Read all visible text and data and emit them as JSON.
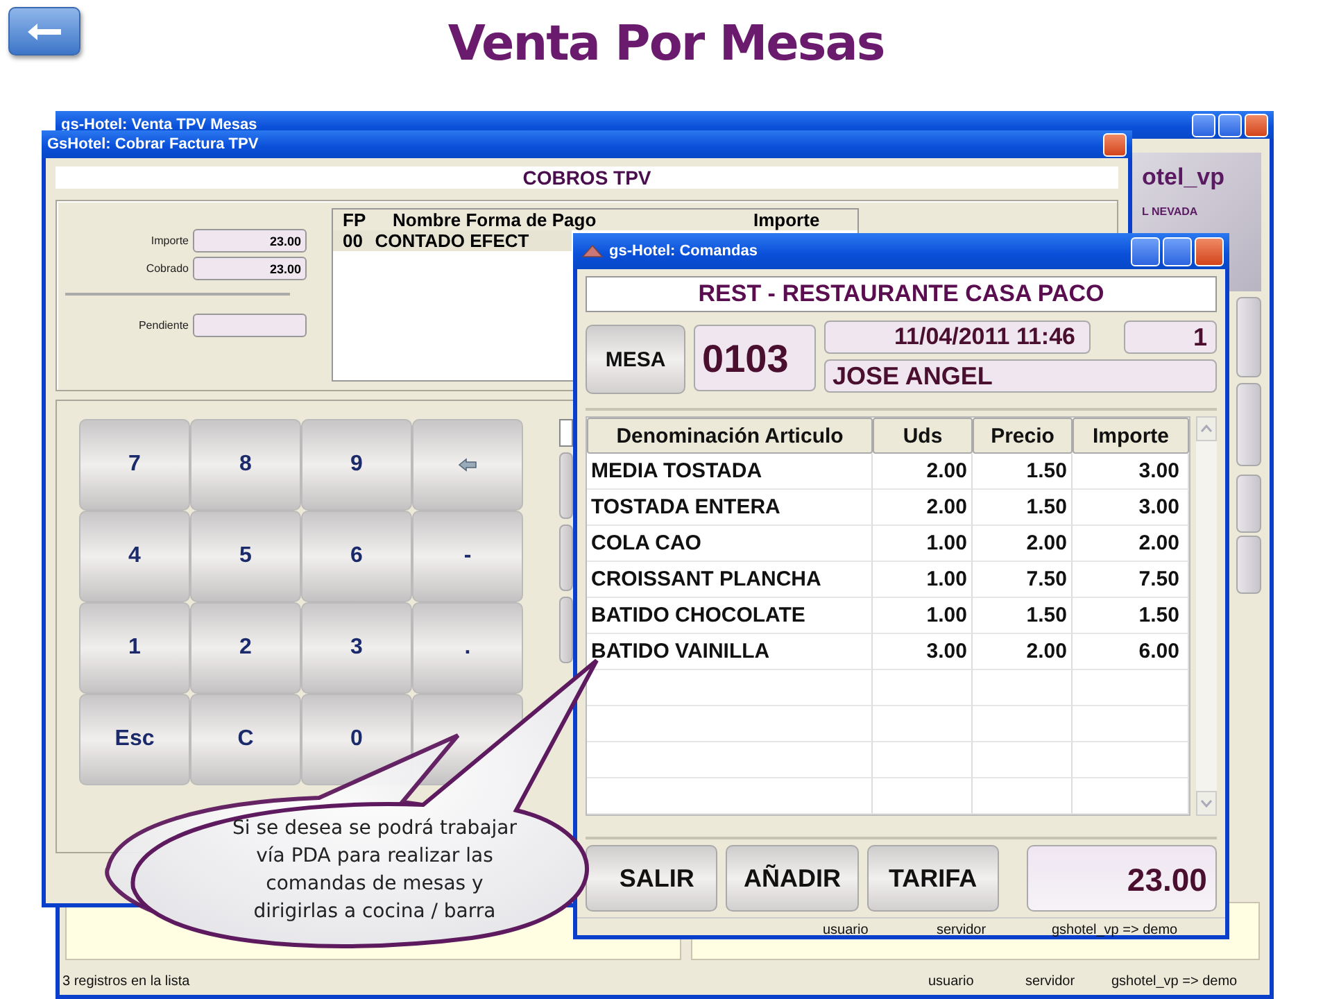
{
  "slide_title": "Venta Por Mesas",
  "main_window": {
    "title": "gs-Hotel: Venta TPV Mesas",
    "logo_text": "otel_vp",
    "logo_subtext": "L NEVADA",
    "status_bar": [
      "3 registros en la lista",
      "usuario",
      "servidor",
      "gshotel_vp => demo"
    ]
  },
  "cobros_window": {
    "title": "GsHotel: Cobrar Factura TPV",
    "header": "COBROS TPV",
    "fields": [
      {
        "label": "Importe",
        "value": "23.00"
      },
      {
        "label": "Cobrado",
        "value": "23.00"
      },
      {
        "label": "Pendiente"
      }
    ],
    "payments": {
      "columns": [
        "FP",
        "Nombre Forma de Pago",
        "Importe"
      ],
      "rows": [
        {
          "cells": [
            "00",
            "CONTADO EFECT"
          ],
          "selected": true
        }
      ]
    },
    "keypad": [
      {
        "kind": "text",
        "label": "7"
      },
      {
        "kind": "text",
        "label": "8"
      },
      {
        "kind": "text",
        "label": "9"
      },
      {
        "kind": "back-arrow"
      },
      {
        "kind": "text",
        "label": "4"
      },
      {
        "kind": "text",
        "label": "5"
      },
      {
        "kind": "text",
        "label": "6"
      },
      {
        "kind": "text",
        "label": "-"
      },
      {
        "kind": "text",
        "label": "1"
      },
      {
        "kind": "text",
        "label": "2"
      },
      {
        "kind": "text",
        "label": "3"
      },
      {
        "kind": "text",
        "label": "."
      },
      {
        "kind": "text",
        "label": "Esc"
      },
      {
        "kind": "text",
        "label": "C"
      },
      {
        "kind": "text",
        "label": "0"
      },
      {
        "kind": "blank"
      }
    ]
  },
  "comandas_window": {
    "title": "gs-Hotel: Comandas",
    "restaurant": "REST - RESTAURANTE CASA PACO",
    "mesa_button": "MESA",
    "table_number": "0103",
    "datetime": "11/04/2011 11:46",
    "count": "1",
    "waiter": "JOSE ANGEL",
    "columns": [
      "Denominación Articulo",
      "Uds",
      "Precio",
      "Importe"
    ],
    "rows": [
      [
        "MEDIA TOSTADA",
        "2.00",
        "1.50",
        "3.00"
      ],
      [
        "TOSTADA ENTERA",
        "2.00",
        "1.50",
        "3.00"
      ],
      [
        "COLA CAO",
        "1.00",
        "2.00",
        "2.00"
      ],
      [
        "CROISSANT PLANCHA",
        "1.00",
        "7.50",
        "7.50"
      ],
      [
        "BATIDO CHOCOLATE",
        "1.00",
        "1.50",
        "1.50"
      ],
      [
        "BATIDO VAINILLA",
        "3.00",
        "2.00",
        "6.00"
      ]
    ],
    "buttons": [
      "SALIR",
      "AÑADIR",
      "TARIFA"
    ],
    "total": "23.00",
    "status_bar": [
      "usuario",
      "servidor",
      "gshotel_vp => demo"
    ]
  },
  "callout": {
    "lines": [
      "Si se desea se podrá trabajar",
      "vía PDA para realizar las",
      "comandas de mesas y",
      "dirigirlas a cocina / barra"
    ]
  }
}
